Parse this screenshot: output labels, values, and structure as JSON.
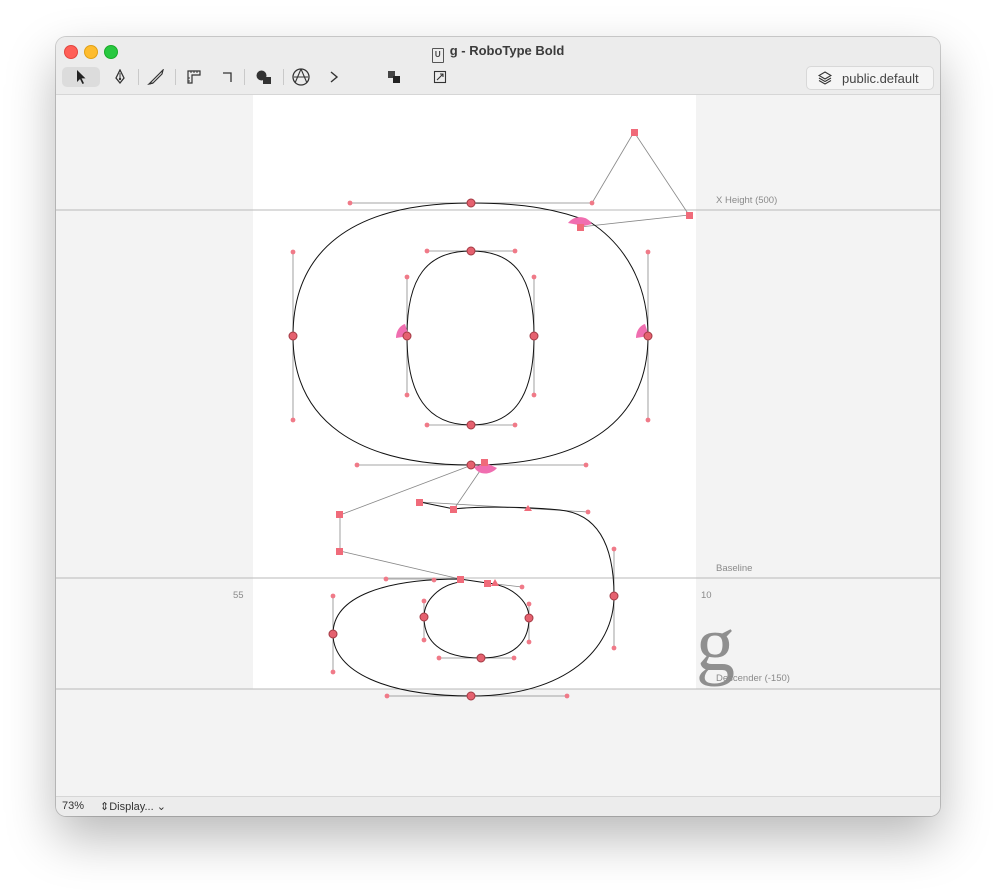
{
  "window": {
    "title": "g - RoboType Bold",
    "doc_icon_letter": "U"
  },
  "toolbar": {
    "tools": [
      {
        "name": "pointer-tool",
        "icon": "arrow-pointer-icon"
      },
      {
        "name": "pen-tool",
        "icon": "pen-nib-icon"
      },
      {
        "name": "knife-tool",
        "icon": "knife-icon"
      },
      {
        "name": "ruler-tool",
        "icon": "ruler-icon"
      },
      {
        "name": "corner-tool",
        "icon": "corner-icon"
      },
      {
        "name": "shapes-tool",
        "icon": "shapes-icon"
      },
      {
        "name": "anchor-tool",
        "icon": "anchor-circle-icon"
      },
      {
        "name": "more-tools",
        "icon": "chevron-right-icon"
      },
      {
        "name": "layers-overlap",
        "icon": "overlap-squares-icon"
      },
      {
        "name": "transform",
        "icon": "transform-square-icon"
      }
    ],
    "layer_label": "public.default"
  },
  "canvas": {
    "guides": {
      "x_height": "X Height (500)",
      "baseline": "Baseline",
      "descender": "Descender (-150)"
    },
    "left_sidebearing": "55",
    "right_sidebearing": "10",
    "preview_glyph": "g"
  },
  "status": {
    "zoom": "73%",
    "display": "Display..."
  },
  "colors": {
    "point": "#e5616f",
    "point_stroke": "#a23a44",
    "start_arrow": "#f06eb0",
    "guide": "#b9b9b9"
  }
}
